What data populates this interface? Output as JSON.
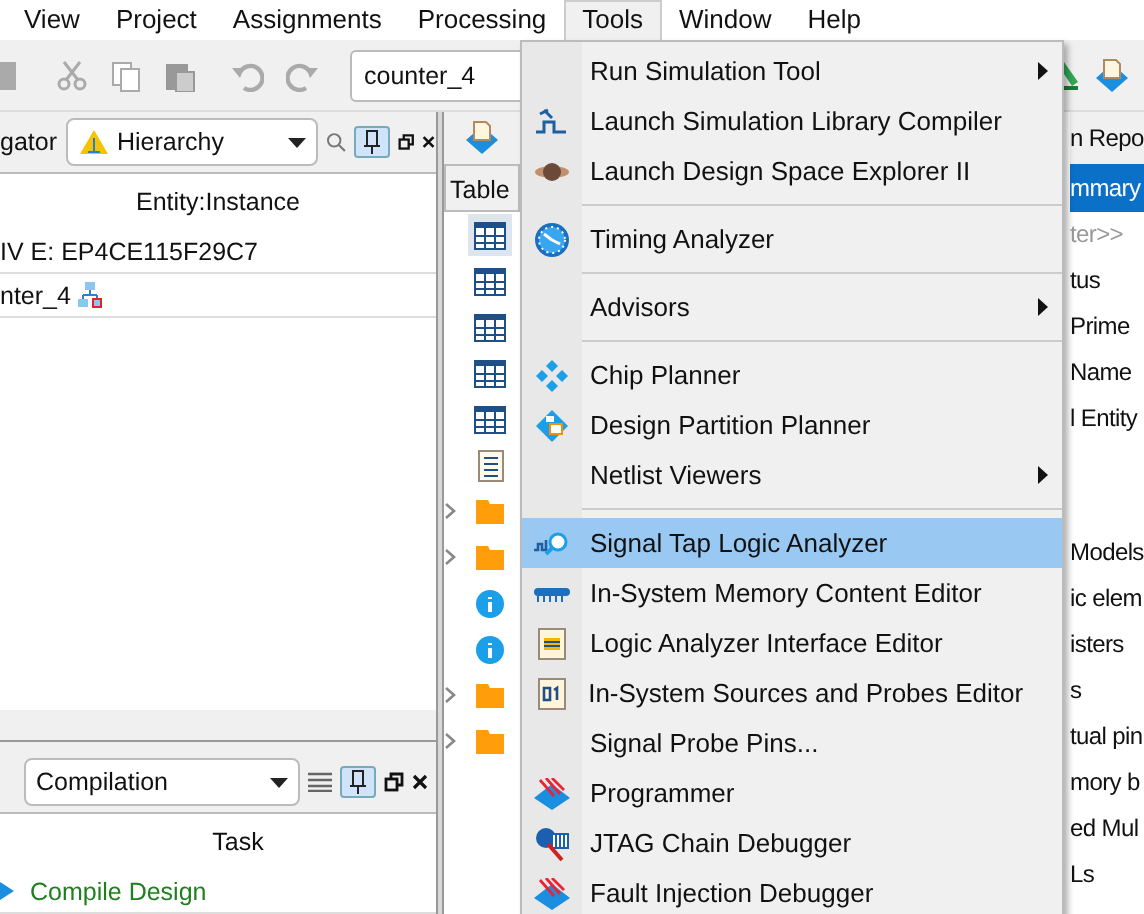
{
  "menu_bar": [
    {
      "label": "View",
      "selected": false
    },
    {
      "label": "Project",
      "selected": false
    },
    {
      "label": "Assignments",
      "selected": false
    },
    {
      "label": "Processing",
      "selected": false
    },
    {
      "label": "Tools",
      "selected": true
    },
    {
      "label": "Window",
      "selected": false
    },
    {
      "label": "Help",
      "selected": false
    }
  ],
  "toolbar": {
    "revision": "counter_4"
  },
  "project_navigator": {
    "title": "gator",
    "view": "Hierarchy",
    "pinned": true,
    "column": "Entity:Instance",
    "rows": [
      {
        "text": "IV E: EP4CE115F29C7",
        "kind": "device"
      },
      {
        "text": "nter_4",
        "kind": "entity"
      }
    ]
  },
  "tasks": {
    "view": "Compilation",
    "pinned": true,
    "column": "Task",
    "rows": [
      {
        "text": "Compile Design"
      }
    ]
  },
  "report": {
    "tab": "n Repo",
    "header": "Table",
    "section": "mmary",
    "filter_placeholder": "ter>>",
    "tree": [
      {
        "kind": "table",
        "selected": true
      },
      {
        "kind": "table",
        "selected": false
      },
      {
        "kind": "table",
        "selected": false
      },
      {
        "kind": "table",
        "selected": false
      },
      {
        "kind": "table",
        "selected": false
      },
      {
        "kind": "document",
        "selected": false
      },
      {
        "kind": "folder",
        "selected": false
      },
      {
        "kind": "folder",
        "selected": false
      },
      {
        "kind": "info",
        "selected": false
      },
      {
        "kind": "info",
        "selected": false
      },
      {
        "kind": "folder",
        "selected": false
      },
      {
        "kind": "folder",
        "selected": false
      }
    ],
    "rows_top": [
      "tus",
      "Prime",
      "Name",
      "l Entity"
    ],
    "rows_bottom": [
      "Models",
      "ic elem",
      "isters",
      "s",
      "tual pin",
      "mory b",
      "ed Mul",
      "Ls"
    ]
  },
  "tools_menu": [
    {
      "kind": "item",
      "label": "Run Simulation Tool",
      "submenu": true,
      "selected": false
    },
    {
      "kind": "item",
      "label": "Launch Simulation Library Compiler",
      "submenu": false,
      "selected": false
    },
    {
      "kind": "item",
      "label": "Launch Design Space Explorer II",
      "submenu": false,
      "selected": false
    },
    {
      "kind": "separator"
    },
    {
      "kind": "item",
      "label": "Timing Analyzer",
      "submenu": false,
      "selected": false
    },
    {
      "kind": "separator"
    },
    {
      "kind": "item",
      "label": "Advisors",
      "submenu": true,
      "selected": false
    },
    {
      "kind": "separator"
    },
    {
      "kind": "item",
      "label": "Chip Planner",
      "submenu": false,
      "selected": false
    },
    {
      "kind": "item",
      "label": "Design Partition Planner",
      "submenu": false,
      "selected": false
    },
    {
      "kind": "item",
      "label": "Netlist Viewers",
      "submenu": true,
      "selected": false
    },
    {
      "kind": "separator"
    },
    {
      "kind": "item",
      "label": "Signal Tap Logic Analyzer",
      "submenu": false,
      "selected": true
    },
    {
      "kind": "item",
      "label": "In-System Memory Content Editor",
      "submenu": false,
      "selected": false
    },
    {
      "kind": "item",
      "label": "Logic Analyzer Interface Editor",
      "submenu": false,
      "selected": false
    },
    {
      "kind": "item",
      "label": "In-System Sources and Probes Editor",
      "submenu": false,
      "selected": false
    },
    {
      "kind": "item",
      "label": "Signal Probe Pins...",
      "submenu": false,
      "selected": false
    },
    {
      "kind": "item",
      "label": "Programmer",
      "submenu": false,
      "selected": false
    },
    {
      "kind": "item",
      "label": "JTAG Chain Debugger",
      "submenu": false,
      "selected": false
    },
    {
      "kind": "item",
      "label": "Fault Injection Debugger",
      "submenu": false,
      "selected": false
    }
  ]
}
